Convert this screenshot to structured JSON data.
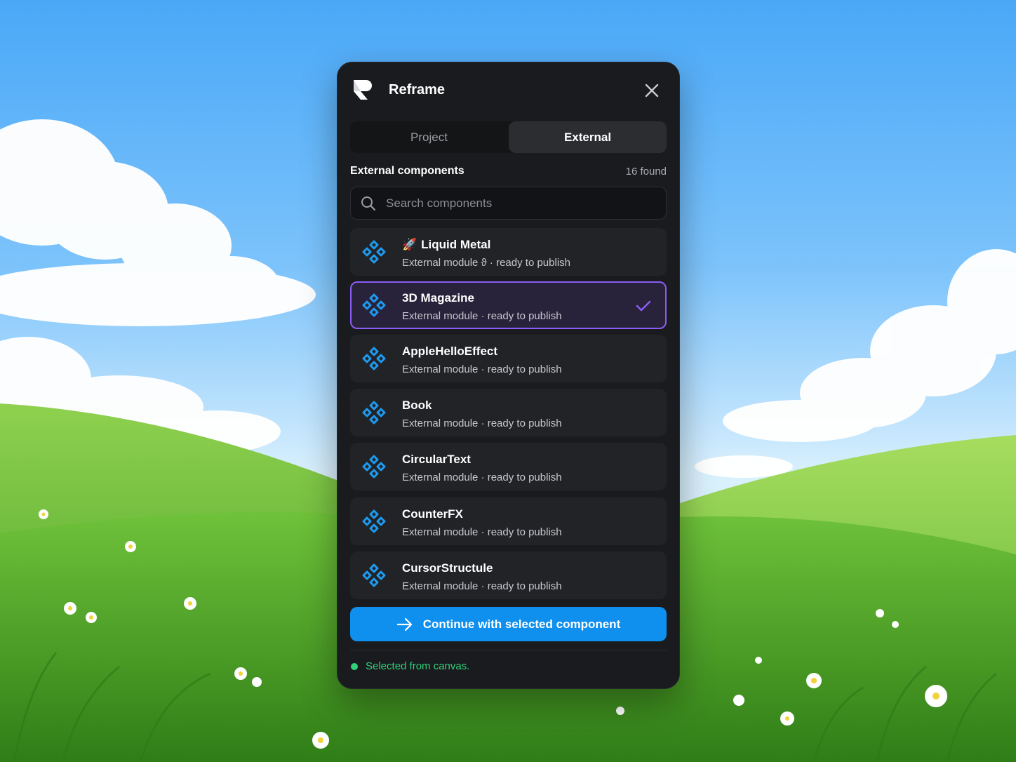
{
  "app": {
    "title": "Reframe",
    "logo_icon": "reframe-logo-icon",
    "close_icon": "close-icon"
  },
  "tabs": [
    {
      "label": "Project",
      "active": false
    },
    {
      "label": "External",
      "active": true
    }
  ],
  "section": {
    "title": "External components",
    "count_label": "16 found"
  },
  "search": {
    "placeholder": "Search components",
    "value": "",
    "icon": "search-icon"
  },
  "components": [
    {
      "emoji": "🚀",
      "name": "Liquid Metal",
      "subtitle": "External module ϑ · ready to publish",
      "selected": false,
      "icon": "component-icon"
    },
    {
      "emoji": "",
      "name": "3D Magazine",
      "subtitle": "External module · ready to publish",
      "selected": true,
      "icon": "component-icon"
    },
    {
      "emoji": "",
      "name": "AppleHelloEffect",
      "subtitle": "External module · ready to publish",
      "selected": false,
      "icon": "component-icon"
    },
    {
      "emoji": "",
      "name": "Book",
      "subtitle": "External module · ready to publish",
      "selected": false,
      "icon": "component-icon"
    },
    {
      "emoji": "",
      "name": "CircularText",
      "subtitle": "External module · ready to publish",
      "selected": false,
      "icon": "component-icon"
    },
    {
      "emoji": "",
      "name": "CounterFX",
      "subtitle": "External module · ready to publish",
      "selected": false,
      "icon": "component-icon"
    },
    {
      "emoji": "",
      "name": "CursorStructule",
      "subtitle": "External module · ready to publish",
      "selected": false,
      "icon": "component-icon"
    }
  ],
  "cta": {
    "label": "Continue with selected component",
    "icon": "arrow-right-icon"
  },
  "status": {
    "text": "Selected from canvas.",
    "color": "#2fd27a"
  },
  "colors": {
    "accent": "#0f8fee",
    "selection": "#8a5cf5",
    "panel": "#1a1b1e",
    "component_icon": "#1d9bf0"
  }
}
